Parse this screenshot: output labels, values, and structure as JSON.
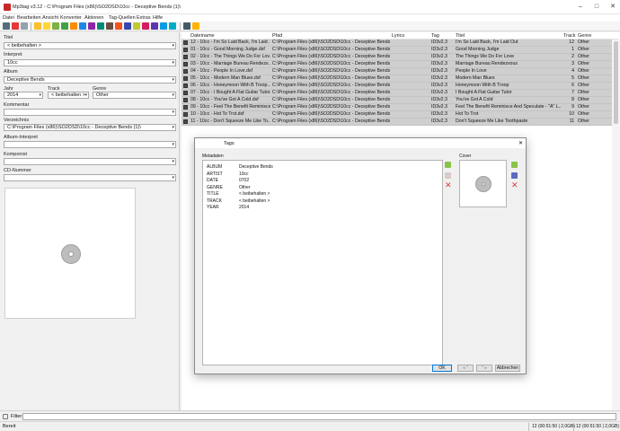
{
  "window": {
    "title": "Mp3tag v3.12  -  C:\\Program Files (x86)\\SO2DSD\\10cc - Deceptive Bends (1)\\",
    "controls": [
      "–",
      "□",
      "✕"
    ]
  },
  "menu": [
    "Datei",
    "Bearbeiten",
    "Ansicht",
    "Konverter",
    "Aktionen",
    "Tag-Quellen",
    "Extras",
    "Hilfe"
  ],
  "left_panel": {
    "titel_label": "Titel",
    "titel_value": "< beibehalten >",
    "interpret_label": "Interpret",
    "interpret_value": "10cc",
    "album_label": "Album",
    "album_value": "Deceptive Bends",
    "jahr_label": "Jahr",
    "jahr_value": "2014",
    "track_label": "Track",
    "track_value": "< beibehalten >",
    "genre_label": "Genre",
    "genre_value": "Other",
    "kommentar_label": "Kommentar",
    "kommentar_value": "",
    "verzeichnis_label": "Verzeichnis",
    "verzeichnis_value": "C:\\Program Files (x86)\\SO2DSD\\10cc - Deceptive Bends (1)\\",
    "album_interpret_label": "Album-Interpret",
    "album_interpret_value": "",
    "komponist_label": "Komponist",
    "komponist_value": "",
    "cd_nummer_label": "CD-Nummer",
    "cd_nummer_value": ""
  },
  "file_list": {
    "columns": [
      "Dateiname",
      "Pfad",
      "Lyrics",
      "Tag",
      "Titel",
      "Track",
      "Genre"
    ],
    "rows": [
      {
        "dateiname": "12 - 10cc - I'm So Laid Back, I'm Laid ...",
        "pfad": "C:\\Program Files (x86)\\SO2DSD\\10cc - Deceptive Bends (1)\\",
        "lyrics": "",
        "tag": "ID3v2.3",
        "titel": "I'm So Laid Back, I'm Laid Out",
        "track": "12",
        "genre": "Other"
      },
      {
        "dateiname": "01 - 10cc - Good Morning Judge.dsf",
        "pfad": "C:\\Program Files (x86)\\SO2DSD\\10cc - Deceptive Bends (1)\\",
        "lyrics": "",
        "tag": "ID3v2.3",
        "titel": "Good Morning Judge",
        "track": "1",
        "genre": "Other"
      },
      {
        "dateiname": "02 - 10cc - The Things We Do For Lov...",
        "pfad": "C:\\Program Files (x86)\\SO2DSD\\10cc - Deceptive Bends (1)\\",
        "lyrics": "",
        "tag": "ID3v2.3",
        "titel": "The Things We Do For Love",
        "track": "2",
        "genre": "Other"
      },
      {
        "dateiname": "03 - 10cc - Marriage Bureau Rendezv...",
        "pfad": "C:\\Program Files (x86)\\SO2DSD\\10cc - Deceptive Bends (1)\\",
        "lyrics": "",
        "tag": "ID3v2.3",
        "titel": "Marriage Bureau Rendezvous",
        "track": "3",
        "genre": "Other"
      },
      {
        "dateiname": "04 - 10cc - People In Love.dsf",
        "pfad": "C:\\Program Files (x86)\\SO2DSD\\10cc - Deceptive Bends (1)\\",
        "lyrics": "",
        "tag": "ID3v2.3",
        "titel": "People In Love",
        "track": "4",
        "genre": "Other"
      },
      {
        "dateiname": "05 - 10cc - Modern Man Blues.dsf",
        "pfad": "C:\\Program Files (x86)\\SO2DSD\\10cc - Deceptive Bends (1)\\",
        "lyrics": "",
        "tag": "ID3v2.3",
        "titel": "Modern Man Blues",
        "track": "5",
        "genre": "Other"
      },
      {
        "dateiname": "06 - 10cc - Honeymoon With B Troop...",
        "pfad": "C:\\Program Files (x86)\\SO2DSD\\10cc - Deceptive Bends (1)\\",
        "lyrics": "",
        "tag": "ID3v2.3",
        "titel": "Honeymoon With B Troop",
        "track": "6",
        "genre": "Other"
      },
      {
        "dateiname": "07 - 10cc - I Bought A Flat Guitar Tutor...",
        "pfad": "C:\\Program Files (x86)\\SO2DSD\\10cc - Deceptive Bends (1)\\",
        "lyrics": "",
        "tag": "ID3v2.3",
        "titel": "I Bought A Flat Guitar Tutor",
        "track": "7",
        "genre": "Other"
      },
      {
        "dateiname": "08 - 10cc - You've Got A Cold.dsf",
        "pfad": "C:\\Program Files (x86)\\SO2DSD\\10cc - Deceptive Bends (1)\\",
        "lyrics": "",
        "tag": "ID3v2.3",
        "titel": "You've Got A Cold",
        "track": "8",
        "genre": "Other"
      },
      {
        "dateiname": "09 - 10cc - Feel The Benefit Reminisce...",
        "pfad": "C:\\Program Files (x86)\\SO2DSD\\10cc - Deceptive Bends (1)\\",
        "lyrics": "",
        "tag": "ID3v2.3",
        "titel": "Feel The Benefit Reminisce And Speculate - \"A\" L...",
        "track": "9",
        "genre": "Other"
      },
      {
        "dateiname": "10 - 10cc - Hot To Trot.dsf",
        "pfad": "C:\\Program Files (x86)\\SO2DSD\\10cc - Deceptive Bends (1)\\",
        "lyrics": "",
        "tag": "ID3v2.3",
        "titel": "Hot To Trot",
        "track": "10",
        "genre": "Other"
      },
      {
        "dateiname": "11 - 10cc - Don't Squeeze Me Like To...",
        "pfad": "C:\\Program Files (x86)\\SO2DSD\\10cc - Deceptive Bends (1)\\",
        "lyrics": "",
        "tag": "ID3v2.3",
        "titel": "Don't Squeeze Me Like Toothpaste",
        "track": "11",
        "genre": "Other"
      }
    ]
  },
  "dialog": {
    "title": "Tags",
    "close": "✕",
    "metadata_label": "Metadaten",
    "cover_label": "Cover",
    "metadata": [
      {
        "key": "ALBUM",
        "value": "Deceptive Bends"
      },
      {
        "key": "ARTIST",
        "value": "10cc"
      },
      {
        "key": "DATE",
        "value": "0702"
      },
      {
        "key": "GENRE",
        "value": "Other"
      },
      {
        "key": "TITLE",
        "value": "< beibehalten >"
      },
      {
        "key": "TRACK",
        "value": "< beibehalten >"
      },
      {
        "key": "YEAR",
        "value": "2014"
      }
    ],
    "ok": "OK",
    "prev": "◂ ^",
    "next": "^ ▸",
    "cancel": "Abbrechen"
  },
  "filter": {
    "label": "Filter:",
    "value": ""
  },
  "status": {
    "left": "Bereit",
    "mid": "12 (00:51:50 | 2,0GB)",
    "right": "12 (00:51:50 | 2,0GB)"
  },
  "colors": {
    "selected_row": "#cfcfcf",
    "accent_red": "#c62828"
  }
}
